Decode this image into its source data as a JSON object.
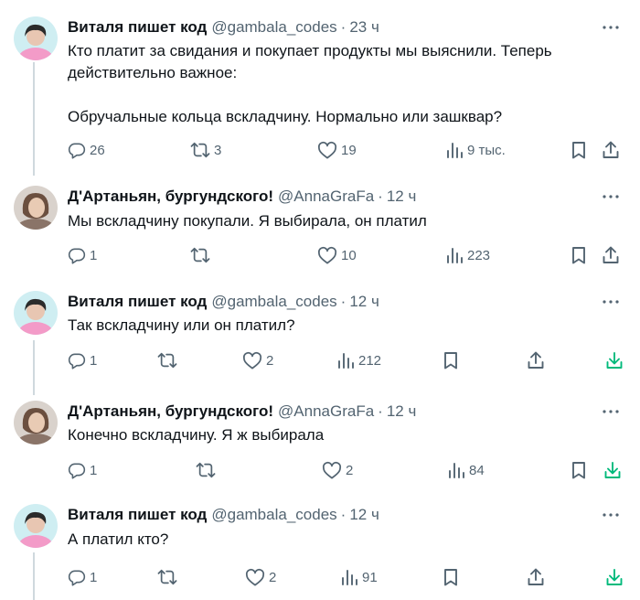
{
  "tweets": [
    {
      "name": "Виталя пишет код",
      "handle": "@gambala_codes",
      "sep": "·",
      "time": "23 ч",
      "text": "Кто платит за свидания и покупает продукты мы выяснили. Теперь\nдействительно важное:\n\nОбручальные кольца вскладчину. Нормально или зашквар?",
      "replies": "26",
      "retweets": "3",
      "likes": "19",
      "views": "9 тыс."
    },
    {
      "name": "Д'Артаньян, бургундского!",
      "handle": "@AnnaGraFa",
      "sep": "·",
      "time": "12 ч",
      "text": "Мы вскладчину покупали. Я выбирала, он платил",
      "replies": "1",
      "retweets": "",
      "likes": "10",
      "views": "223"
    },
    {
      "name": "Виталя пишет код",
      "handle": "@gambala_codes",
      "sep": "·",
      "time": "12 ч",
      "text": "Так вскладчину или он платил?",
      "replies": "1",
      "retweets": "",
      "likes": "2",
      "views": "212"
    },
    {
      "name": "Д'Артаньян, бургундского!",
      "handle": "@AnnaGraFa",
      "sep": "·",
      "time": "12 ч",
      "text": "Конечно вскладчину. Я ж выбирала",
      "replies": "1",
      "retweets": "",
      "likes": "2",
      "views": "84"
    },
    {
      "name": "Виталя пишет код",
      "handle": "@gambala_codes",
      "sep": "·",
      "time": "12 ч",
      "text": "А платил кто?",
      "replies": "1",
      "retweets": "",
      "likes": "2",
      "views": "91"
    }
  ],
  "icons": {
    "reply": "reply-icon",
    "retweet": "retweet-icon",
    "like": "like-icon",
    "views": "views-icon",
    "bookmark": "bookmark-icon",
    "share": "share-icon",
    "download": "download-icon",
    "more": "more-icon"
  },
  "colors": {
    "text": "#0f1419",
    "secondary": "#536471",
    "download_green": "#00ba7c",
    "thread_line": "#cfd9de"
  }
}
